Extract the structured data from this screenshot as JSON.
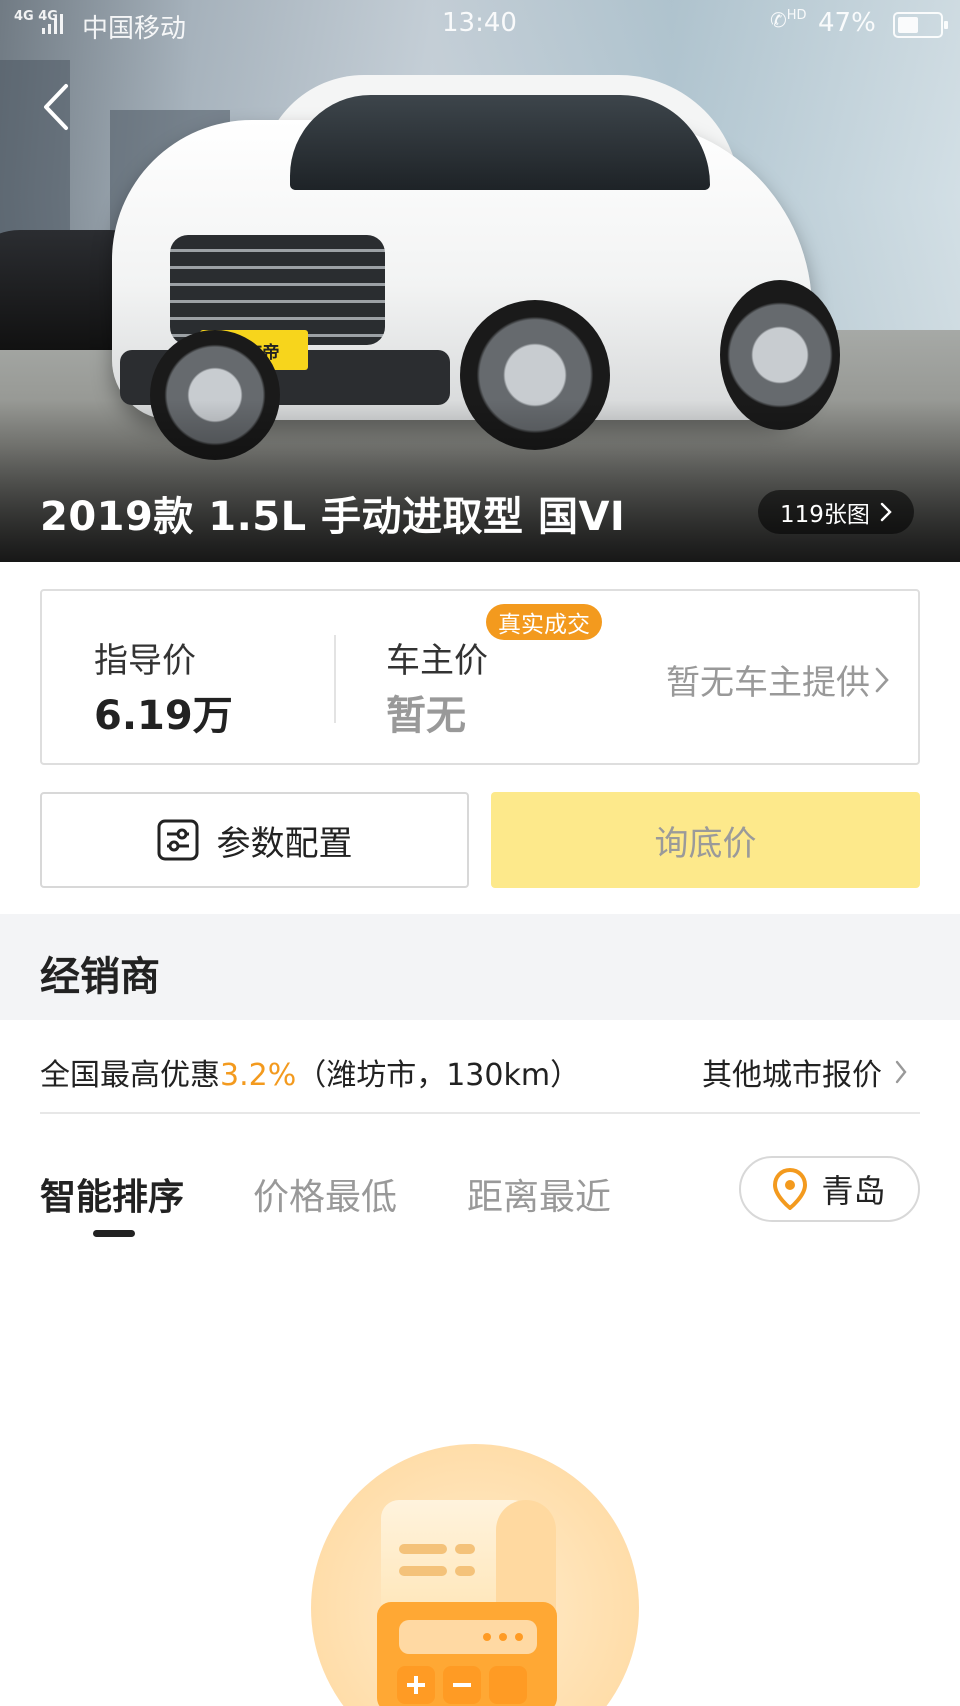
{
  "status_bar": {
    "network": "4G 4G",
    "carrier": "中国移动",
    "time": "13:40",
    "call_hd": "HD",
    "battery": "47%"
  },
  "hero": {
    "title": "2019款 1.5L 手动进取型 国VI",
    "photo_count": "119张图",
    "plate_text": "懂车帝"
  },
  "price": {
    "guide_label": "指导价",
    "guide_value": "6.19万",
    "owner_label": "车主价",
    "owner_badge": "真实成交",
    "owner_value": "暂无",
    "owner_link": "暂无车主提供"
  },
  "actions": {
    "config_label": "参数配置",
    "inquiry_label": "询底价"
  },
  "dealer": {
    "section_title": "经销商",
    "promo_prefix": "全国最高优惠",
    "promo_percent": "3.2%",
    "promo_suffix": "（潍坊市，130km）",
    "other_cities": "其他城市报价"
  },
  "sort": {
    "tabs": [
      "智能排序",
      "价格最低",
      "距离最近"
    ],
    "active_index": 0,
    "city": "青岛"
  },
  "colors": {
    "accent": "#f39a1e",
    "inquiry_button_bg": "#fde98b",
    "section_bg": "#f3f4f6"
  }
}
